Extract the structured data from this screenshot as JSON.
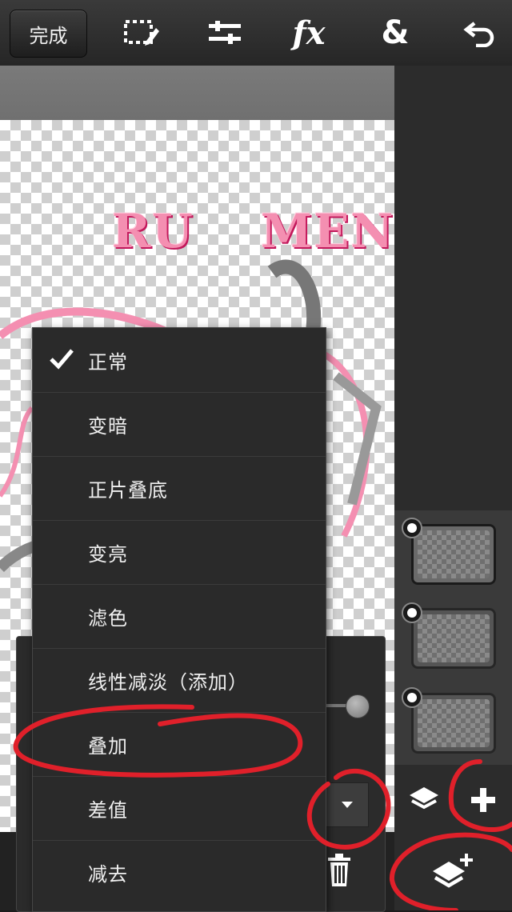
{
  "toolbar": {
    "done_label": "完成",
    "icons": [
      "selection-icon",
      "adjust-icon",
      "fx-icon",
      "blend-icon",
      "undo-icon"
    ],
    "fx_glyph": "fx",
    "blend_glyph": "&"
  },
  "canvas": {
    "art_text_left": "RU",
    "art_text_right": "MEN"
  },
  "blend_menu": {
    "items": [
      {
        "label": "正常",
        "selected": true
      },
      {
        "label": "变暗",
        "selected": false
      },
      {
        "label": "正片叠底",
        "selected": false
      },
      {
        "label": "变亮",
        "selected": false
      },
      {
        "label": "滤色",
        "selected": false
      },
      {
        "label": "线性减淡（添加）",
        "selected": false
      },
      {
        "label": "叠加",
        "selected": false
      },
      {
        "label": "差值",
        "selected": false
      },
      {
        "label": "减去",
        "selected": false
      }
    ]
  },
  "layers": {
    "count": 3,
    "selected_index": 0
  },
  "colors": {
    "annotation_red": "#e0202a",
    "art_pink": "#f48fb1",
    "menu_bg": "#2a2a2a"
  }
}
